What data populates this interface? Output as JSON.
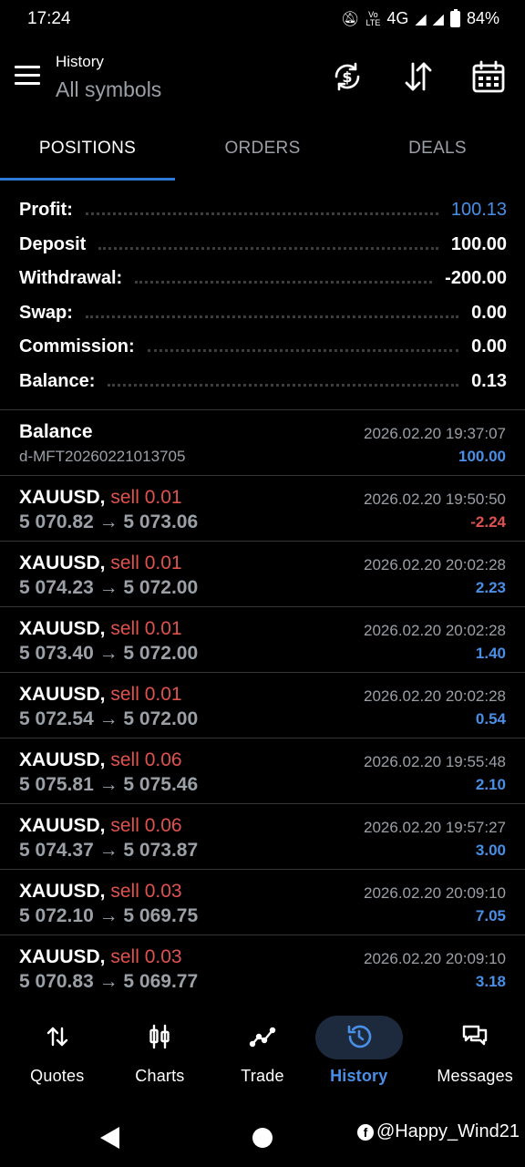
{
  "status_bar": {
    "time": "17:24",
    "network": "4G",
    "battery": "84%",
    "volte_label": "VoLTE"
  },
  "header": {
    "subtitle": "History",
    "title": "All symbols"
  },
  "tabs": [
    {
      "label": "POSITIONS",
      "active": true
    },
    {
      "label": "ORDERS",
      "active": false
    },
    {
      "label": "DEALS",
      "active": false
    }
  ],
  "summary": {
    "profit_label": "Profit:",
    "profit_value": "100.13",
    "deposit_label": "Deposit",
    "deposit_value": "100.00",
    "withdrawal_label": "Withdrawal:",
    "withdrawal_value": "-200.00",
    "swap_label": "Swap:",
    "swap_value": "0.00",
    "commission_label": "Commission:",
    "commission_value": "0.00",
    "balance_label": "Balance:",
    "balance_value": "0.13"
  },
  "balance_entry": {
    "title": "Balance",
    "id": "d-MFT20260221013705",
    "time": "2026.02.20 19:37:07",
    "amount": "100.00"
  },
  "positions": [
    {
      "symbol": "XAUUSD,",
      "side": "sell 0.01",
      "prices": "5 070.82 → 5 073.06",
      "time": "2026.02.20 19:50:50",
      "profit": "-2.24",
      "negative": true
    },
    {
      "symbol": "XAUUSD,",
      "side": "sell 0.01",
      "prices": "5 074.23 → 5 072.00",
      "time": "2026.02.20 20:02:28",
      "profit": "2.23",
      "negative": false
    },
    {
      "symbol": "XAUUSD,",
      "side": "sell 0.01",
      "prices": "5 073.40 → 5 072.00",
      "time": "2026.02.20 20:02:28",
      "profit": "1.40",
      "negative": false
    },
    {
      "symbol": "XAUUSD,",
      "side": "sell 0.01",
      "prices": "5 072.54 → 5 072.00",
      "time": "2026.02.20 20:02:28",
      "profit": "0.54",
      "negative": false
    },
    {
      "symbol": "XAUUSD,",
      "side": "sell 0.06",
      "prices": "5 075.81 → 5 075.46",
      "time": "2026.02.20 19:55:48",
      "profit": "2.10",
      "negative": false
    },
    {
      "symbol": "XAUUSD,",
      "side": "sell 0.06",
      "prices": "5 074.37 → 5 073.87",
      "time": "2026.02.20 19:57:27",
      "profit": "3.00",
      "negative": false
    },
    {
      "symbol": "XAUUSD,",
      "side": "sell 0.03",
      "prices": "5 072.10 → 5 069.75",
      "time": "2026.02.20 20:09:10",
      "profit": "7.05",
      "negative": false
    },
    {
      "symbol": "XAUUSD,",
      "side": "sell 0.03",
      "prices": "5 070.83 → 5 069.77",
      "time": "2026.02.20 20:09:10",
      "profit": "3.18",
      "negative": false
    }
  ],
  "bottom_nav": [
    {
      "label": "Quotes",
      "icon": "quotes-icon",
      "active": false
    },
    {
      "label": "Charts",
      "icon": "charts-icon",
      "active": false
    },
    {
      "label": "Trade",
      "icon": "trade-icon",
      "active": false
    },
    {
      "label": "History",
      "icon": "history-icon",
      "active": true
    },
    {
      "label": "Messages",
      "icon": "messages-icon",
      "active": false
    }
  ],
  "watermark": "@Happy_Wind21",
  "colors": {
    "accent": "#4a8fe7",
    "negative": "#e0524f",
    "muted": "#9aa0a6",
    "background": "#000000"
  }
}
